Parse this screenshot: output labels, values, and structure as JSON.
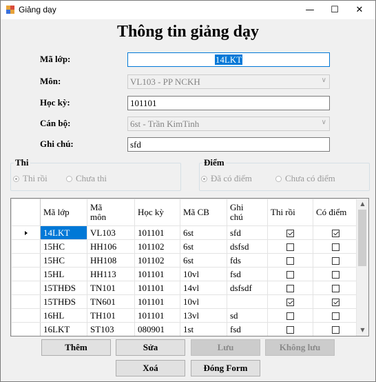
{
  "window": {
    "title": "Giảng dạy",
    "minimize": "—",
    "maximize": "☐",
    "close": "✕"
  },
  "heading": "Thông tin giảng dạy",
  "form": {
    "ma_lop": {
      "label": "Mã lớp:",
      "value": "14LKT"
    },
    "mon": {
      "label": "Môn:",
      "value": "VL103 - PP NCKH"
    },
    "hoc_ky": {
      "label": "Học kỳ:",
      "value": "101101"
    },
    "can_bo": {
      "label": "Cán bộ:",
      "value": "6st - Trần KimTinh"
    },
    "ghi_chu": {
      "label": "Ghi chú:",
      "value": "sfd"
    }
  },
  "group_thi": {
    "title": "Thi",
    "options": [
      "Thi rồi",
      "Chưa thi"
    ],
    "selected": 0
  },
  "group_diem": {
    "title": "Điểm",
    "options": [
      "Đã có điểm",
      "Chưa có điểm"
    ],
    "selected": 0
  },
  "grid": {
    "columns": [
      "Mã lớp",
      "Mã\nmôn",
      "Học kỳ",
      "Mã CB",
      "Ghi\nchú",
      "Thi rồi",
      "Có điểm"
    ],
    "rows": [
      {
        "ma_lop": "14LKT",
        "ma_mon": "VL103",
        "hoc_ky": "101101",
        "ma_cb": "6st",
        "ghi_chu": "sfd",
        "thi_roi": true,
        "co_diem": true
      },
      {
        "ma_lop": "15HC",
        "ma_mon": "HH106",
        "hoc_ky": "101102",
        "ma_cb": "6st",
        "ghi_chu": "dsfsd",
        "thi_roi": false,
        "co_diem": false
      },
      {
        "ma_lop": "15HC",
        "ma_mon": "HH108",
        "hoc_ky": "101102",
        "ma_cb": "6st",
        "ghi_chu": "fds",
        "thi_roi": false,
        "co_diem": false
      },
      {
        "ma_lop": "15HL",
        "ma_mon": "HH113",
        "hoc_ky": "101101",
        "ma_cb": "10vl",
        "ghi_chu": "fsd",
        "thi_roi": false,
        "co_diem": false
      },
      {
        "ma_lop": "15THĐS",
        "ma_mon": "TN101",
        "hoc_ky": "101101",
        "ma_cb": "14vl",
        "ghi_chu": "dsfsdf",
        "thi_roi": false,
        "co_diem": false
      },
      {
        "ma_lop": "15THĐS",
        "ma_mon": "TN601",
        "hoc_ky": "101101",
        "ma_cb": "10vl",
        "ghi_chu": "",
        "thi_roi": true,
        "co_diem": true
      },
      {
        "ma_lop": "16HL",
        "ma_mon": "TH101",
        "hoc_ky": "101101",
        "ma_cb": "13vl",
        "ghi_chu": "sd",
        "thi_roi": false,
        "co_diem": false
      },
      {
        "ma_lop": "16LKT",
        "ma_mon": "ST103",
        "hoc_ky": "080901",
        "ma_cb": "1st",
        "ghi_chu": "fsd",
        "thi_roi": false,
        "co_diem": false
      }
    ],
    "current_row": 0
  },
  "buttons": {
    "them": "Thêm",
    "sua": "Sửa",
    "luu": "Lưu",
    "khong_luu": "Không lưu",
    "xoa": "Xoá",
    "dong_form": "Đóng Form"
  },
  "colors": {
    "selection": "#0078d7",
    "disabled_button": "#cccccc"
  }
}
